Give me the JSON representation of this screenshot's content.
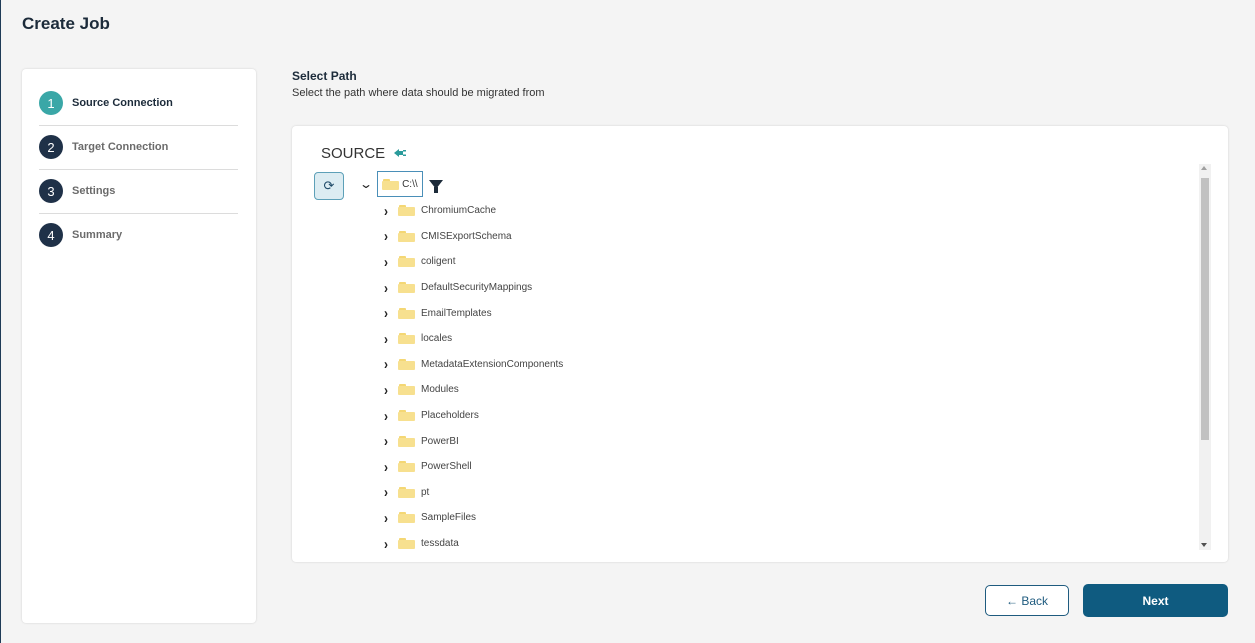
{
  "page": {
    "title": "Create Job"
  },
  "wizard": {
    "steps": [
      {
        "number": "1",
        "label": "Source Connection",
        "active": true
      },
      {
        "number": "2",
        "label": "Target Connection",
        "active": false
      },
      {
        "number": "3",
        "label": "Settings",
        "active": false
      },
      {
        "number": "4",
        "label": "Summary",
        "active": false
      }
    ]
  },
  "section": {
    "title": "Select Path",
    "subtitle": "Select the path where data should be migrated from"
  },
  "source": {
    "label": "SOURCE",
    "plug_icon": "plug-icon",
    "refresh_icon": "refresh-icon",
    "root_path": "C:\\\\",
    "filter_icon": "filter-icon",
    "folders": [
      "ChromiumCache",
      "CMISExportSchema",
      "coligent",
      "DefaultSecurityMappings",
      "EmailTemplates",
      "locales",
      "MetadataExtensionComponents",
      "Modules",
      "Placeholders",
      "PowerBI",
      "PowerShell",
      "pt",
      "SampleFiles",
      "tessdata"
    ]
  },
  "footer": {
    "back_label": "← Back",
    "next_label": "Next"
  },
  "colors": {
    "primary": "#0f5b80",
    "active_step": "#3aa7a7",
    "step_circle": "#1f3148",
    "folder": "#f7e08f"
  }
}
